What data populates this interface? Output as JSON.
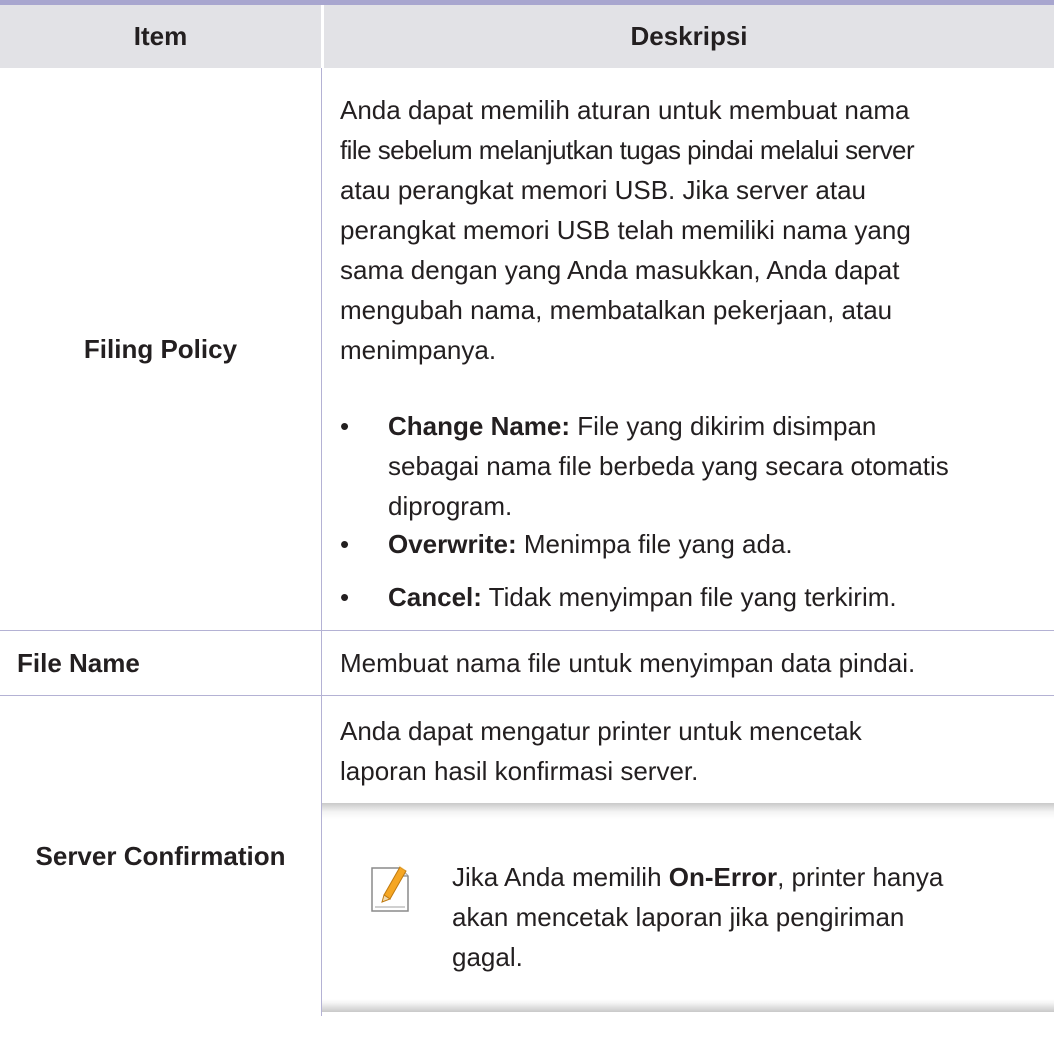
{
  "header": {
    "item": "Item",
    "description": "Deskripsi"
  },
  "rows": [
    {
      "item": "Filing Policy",
      "description_lines": [
        "Anda dapat memilih aturan untuk membuat nama",
        "file sebelum melanjutkan tugas pindai melalui server",
        "atau perangkat memori USB. Jika server atau",
        "perangkat memori USB telah memiliki nama yang",
        "sama dengan yang Anda masukkan, Anda dapat",
        "mengubah nama, membatalkan pekerjaan, atau",
        "menimpanya."
      ],
      "bullets": [
        {
          "term": "Change Name:",
          "lines": [
            " File yang dikirim disimpan",
            "sebagai nama file berbeda yang secara otomatis",
            "diprogram."
          ]
        },
        {
          "term": "Overwrite:",
          "lines": [
            " Menimpa file yang ada."
          ]
        },
        {
          "term": "Cancel:",
          "lines": [
            " Tidak menyimpan file yang terkirim."
          ]
        }
      ]
    },
    {
      "item": "File Name",
      "description": "Membuat nama file untuk menyimpan data pindai."
    },
    {
      "item": "Server Confirmation",
      "description_lines": [
        "Anda dapat mengatur printer untuk mencetak",
        "laporan hasil konfirmasi server."
      ],
      "note": {
        "icon": "note-pencil-icon",
        "prefix": "Jika Anda memilih ",
        "emphasis": "On-Error",
        "suffix": ", printer hanya",
        "lines": [
          "akan mencetak laporan jika pengiriman",
          "gagal."
        ]
      }
    }
  ],
  "colors": {
    "header_bg": "#e2e2e6",
    "top_rule": "#a8a6cf",
    "grid_line": "#b4b2d4",
    "text": "#231f20",
    "note_icon_accent": "#f5a623"
  }
}
